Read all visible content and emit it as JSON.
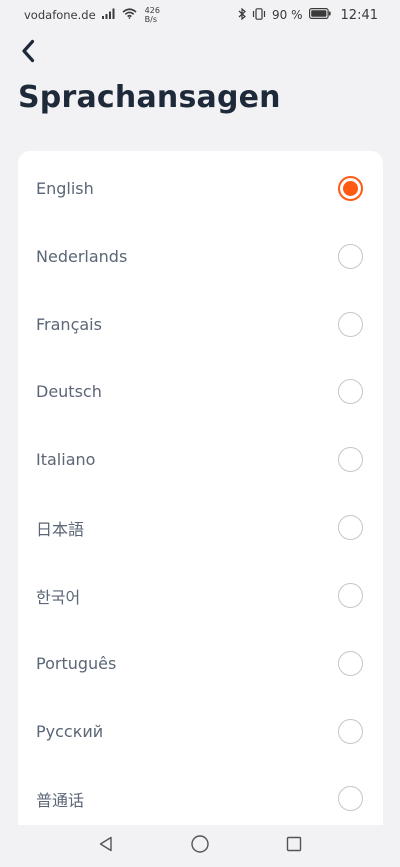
{
  "status_bar": {
    "carrier": "vodafone.de",
    "speed_value": "426",
    "speed_unit": "B/s",
    "battery_percent": "90 %",
    "time": "12:41",
    "icons": [
      "signal-icon",
      "wifi-icon",
      "bluetooth-icon",
      "vibrate-icon",
      "battery-icon"
    ]
  },
  "header": {
    "back_icon": "chevron-left-icon",
    "title": "Sprachansagen"
  },
  "languages": [
    {
      "label": "English",
      "selected": true
    },
    {
      "label": "Nederlands",
      "selected": false
    },
    {
      "label": "Français",
      "selected": false
    },
    {
      "label": "Deutsch",
      "selected": false
    },
    {
      "label": "Italiano",
      "selected": false
    },
    {
      "label": "日本語",
      "selected": false
    },
    {
      "label": "한국어",
      "selected": false
    },
    {
      "label": "Português",
      "selected": false
    },
    {
      "label": "Русский",
      "selected": false
    },
    {
      "label": "普通话",
      "selected": false
    }
  ],
  "colors": {
    "accent": "#ff5a14",
    "title": "#1e2a3a",
    "label": "#5b6676",
    "background": "#f2f2f4",
    "card": "#ffffff"
  },
  "nav_bar": {
    "icons": [
      "back-triangle-icon",
      "home-circle-icon",
      "recents-square-icon"
    ]
  }
}
